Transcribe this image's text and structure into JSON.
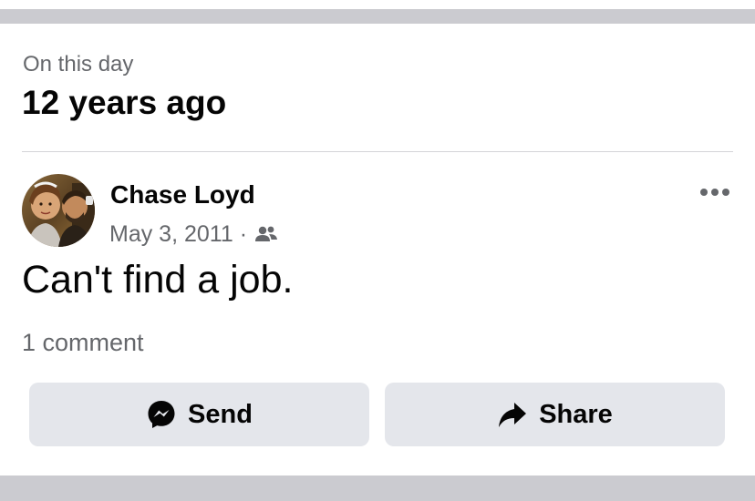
{
  "memory": {
    "label": "On this day",
    "title": "12 years ago"
  },
  "post": {
    "author": "Chase Loyd",
    "date": "May 3, 2011",
    "separator": "·",
    "audience_icon": "friends-icon",
    "text": "Can't find a job.",
    "comments": "1 comment",
    "more_icon": "more-options-icon"
  },
  "actions": {
    "send_label": "Send",
    "send_icon": "messenger-icon",
    "share_label": "Share",
    "share_icon": "share-arrow-icon"
  },
  "colors": {
    "band": "#cbcbd0",
    "button_bg": "#e4e6eb",
    "secondary_text": "#65676b",
    "primary_text": "#050505"
  }
}
